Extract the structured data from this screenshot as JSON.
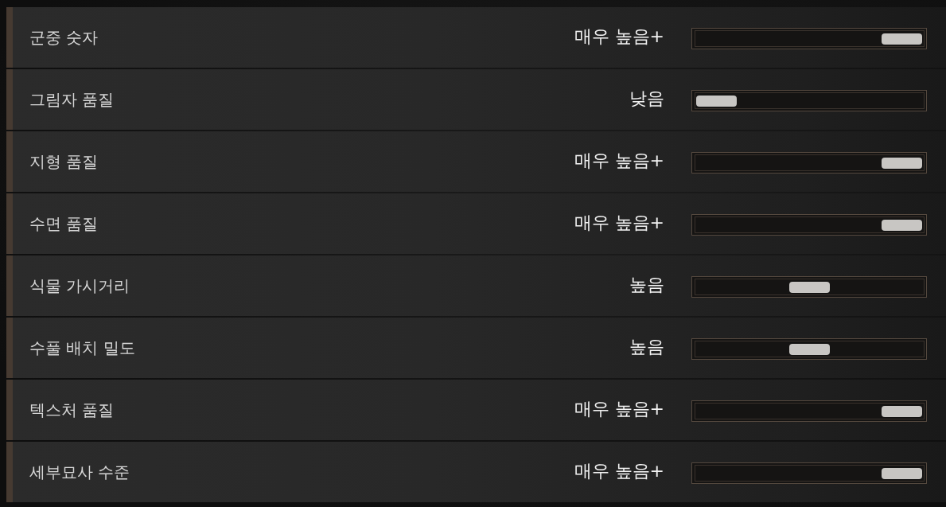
{
  "settings": [
    {
      "label": "군중 숫자",
      "value": "매우 높음+",
      "level": 1
    },
    {
      "label": "그림자 품질",
      "value": "낮음",
      "level": 0
    },
    {
      "label": "지형 품질",
      "value": "매우 높음+",
      "level": 1
    },
    {
      "label": "수면 품질",
      "value": "매우 높음+",
      "level": 1
    },
    {
      "label": "식물 가시거리",
      "value": "높음",
      "level": 0.5
    },
    {
      "label": "수풀 배치 밀도",
      "value": "높음",
      "level": 0.5
    },
    {
      "label": "텍스처 품질",
      "value": "매우 높음+",
      "level": 1
    },
    {
      "label": "세부묘사 수준",
      "value": "매우 높음+",
      "level": 1
    }
  ]
}
